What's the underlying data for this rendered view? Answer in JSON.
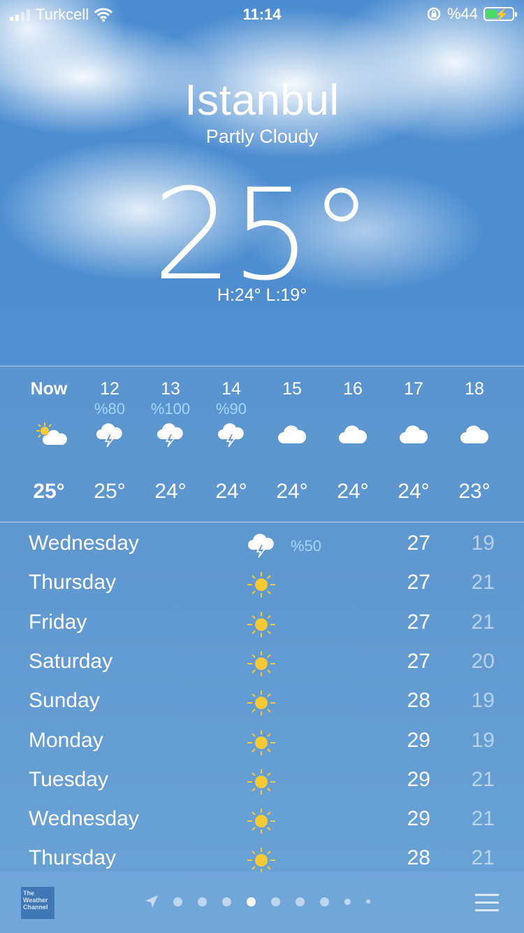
{
  "status": {
    "carrier": "Turkcell",
    "time": "11:14",
    "battery": "%44"
  },
  "header": {
    "city": "Istanbul",
    "condition": "Partly Cloudy",
    "temp": "25°",
    "hilo": "H:24° L:19°"
  },
  "hourly": [
    {
      "label": "Now",
      "pct": "",
      "temp": "25°",
      "icon": "partly-sunny-icon"
    },
    {
      "label": "12",
      "pct": "%80",
      "temp": "25°",
      "icon": "thunderstorm-icon"
    },
    {
      "label": "13",
      "pct": "%100",
      "temp": "24°",
      "icon": "thunderstorm-icon"
    },
    {
      "label": "14",
      "pct": "%90",
      "temp": "24°",
      "icon": "thunderstorm-icon"
    },
    {
      "label": "15",
      "pct": "",
      "temp": "24°",
      "icon": "cloud-icon"
    },
    {
      "label": "16",
      "pct": "",
      "temp": "24°",
      "icon": "cloud-icon"
    },
    {
      "label": "17",
      "pct": "",
      "temp": "24°",
      "icon": "cloud-icon"
    },
    {
      "label": "18",
      "pct": "",
      "temp": "23°",
      "icon": "cloud-icon"
    }
  ],
  "daily": [
    {
      "name": "Wednesday",
      "pct": "%50",
      "hi": "27",
      "lo": "19",
      "icon": "thunderstorm-icon"
    },
    {
      "name": "Thursday",
      "pct": "",
      "hi": "27",
      "lo": "21",
      "icon": "sun-icon"
    },
    {
      "name": "Friday",
      "pct": "",
      "hi": "27",
      "lo": "21",
      "icon": "sun-icon"
    },
    {
      "name": "Saturday",
      "pct": "",
      "hi": "27",
      "lo": "20",
      "icon": "sun-icon"
    },
    {
      "name": "Sunday",
      "pct": "",
      "hi": "28",
      "lo": "19",
      "icon": "sun-icon"
    },
    {
      "name": "Monday",
      "pct": "",
      "hi": "29",
      "lo": "19",
      "icon": "sun-icon"
    },
    {
      "name": "Tuesday",
      "pct": "",
      "hi": "29",
      "lo": "21",
      "icon": "sun-icon"
    },
    {
      "name": "Wednesday",
      "pct": "",
      "hi": "29",
      "lo": "21",
      "icon": "sun-icon"
    },
    {
      "name": "Thursday",
      "pct": "",
      "hi": "28",
      "lo": "21",
      "icon": "sun-icon"
    }
  ],
  "footer": {
    "weather_channel": "The Weather Channel",
    "active_page": 4
  }
}
